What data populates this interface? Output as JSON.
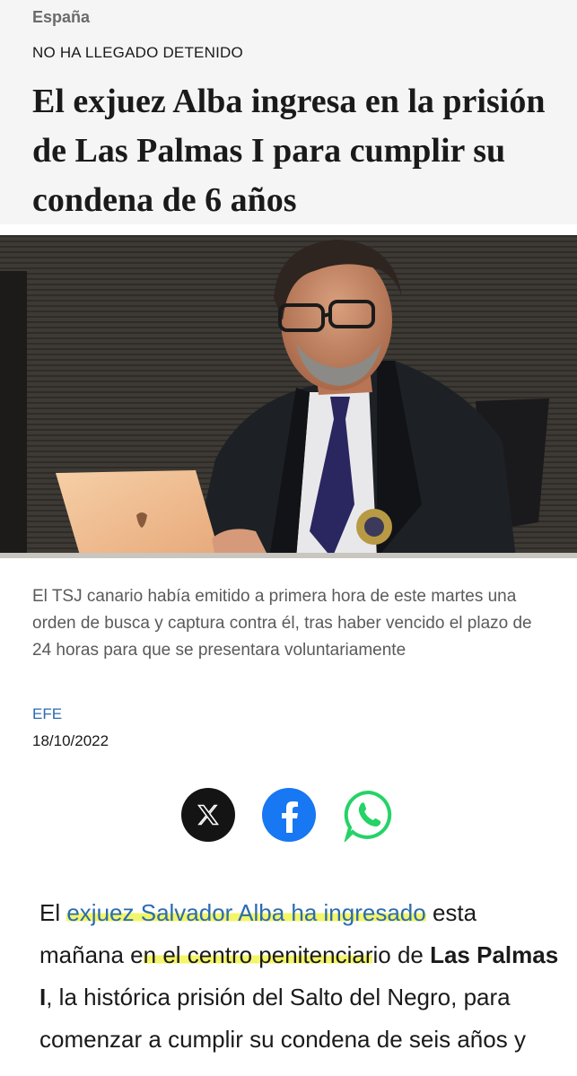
{
  "article": {
    "section": "España",
    "kicker": "NO HA LLEGADO DETENIDO",
    "headline": "El exjuez Alba ingresa en la prisión de Las Palmas I para cumplir su condena de 6 años",
    "caption": "El TSJ canario había emitido a primera hora de este martes una orden de busca y captura contra él, tras haber vencido el plazo de 24 horas para que se presentara voluntariamente",
    "credit": "EFE",
    "date": "18/10/2022"
  },
  "share": {
    "x_icon": "x-logo-icon",
    "facebook_icon": "facebook-logo-icon",
    "whatsapp_icon": "whatsapp-logo-icon"
  },
  "body": {
    "p1_start": "El ",
    "p1_link": "exjuez Salvador Alba ha ingresado",
    "p1_mid1": " esta mañana e",
    "p1_hl2": "n el centro penitenciar",
    "p1_mid2": "io de ",
    "p1_bold": "Las Palmas I",
    "p1_end": ", la histórica prisión del Salto del Negro, para comenzar a cumplir su condena de seis años y"
  },
  "colors": {
    "link": "#2a6bb0",
    "highlight": "#f3f56a",
    "header_bg": "#f5f5f5",
    "facebook": "#1877f2",
    "whatsapp": "#25d366"
  }
}
